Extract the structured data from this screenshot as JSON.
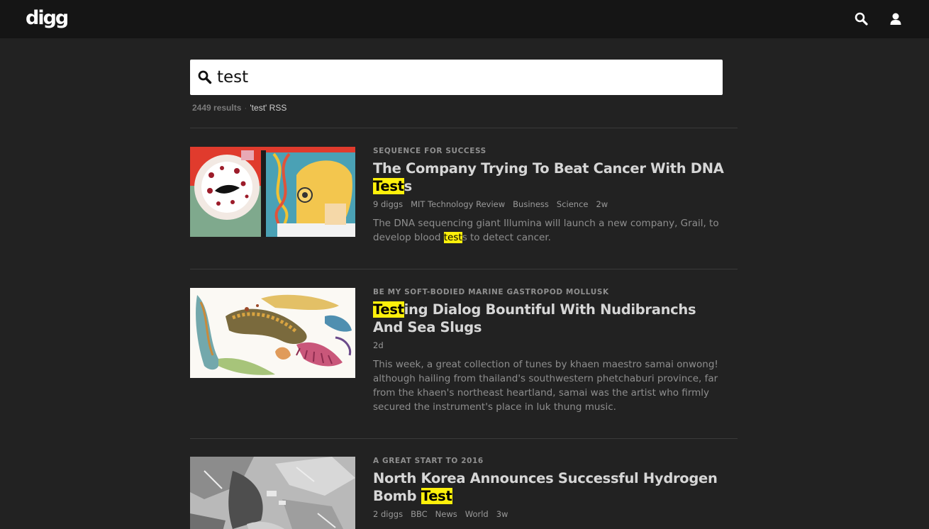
{
  "header": {
    "logo": "digg",
    "search_icon": "search-icon",
    "user_icon": "user-icon"
  },
  "search": {
    "value": "test",
    "icon": "search-icon",
    "results_count": "2449 results",
    "separator": "·",
    "rss_link": "'test' RSS"
  },
  "colors": {
    "background": "#222222",
    "topbar": "#151515",
    "highlight": "#fdf00b",
    "title": "#d6d6d6",
    "meta": "#9a9a9a"
  },
  "stories": [
    {
      "kicker": "SEQUENCE FOR SUCCESS",
      "title_pre": "The Company Trying To Beat Cancer With DNA ",
      "title_hl": "Test",
      "title_post": "s",
      "diggs": "9 diggs",
      "source": "MIT Technology Review",
      "tags": [
        "Business",
        "Science"
      ],
      "age": "2w",
      "desc_pre": "The DNA sequencing giant Illumina will launch a new company, Grail, to develop blood ",
      "desc_hl": "test",
      "desc_post": "s to detect cancer.",
      "image": "illustration-dna-test"
    },
    {
      "kicker": "BE MY SOFT-BODIED MARINE GASTROPOD MOLLUSK",
      "title_pre": "",
      "title_hl": "Test",
      "title_post": "ing Dialog Bountiful With Nudibranchs And Sea Slugs",
      "diggs": "",
      "source": "",
      "tags": [],
      "age": "2d",
      "desc_pre": "This week, a great collection of tunes by khaen maestro samai onwong! although hailing from thailand's southwestern phetchaburi province, far from the khaen's northeast heartland, samai was the artist who firmly secured the instrument's place in luk thung music.",
      "desc_hl": "",
      "desc_post": "",
      "image": "illustration-nudibranchs"
    },
    {
      "kicker": "A GREAT START TO 2016",
      "title_pre": "North Korea Announces Successful Hydrogen Bomb ",
      "title_hl": "Test",
      "title_post": "",
      "diggs": "2 diggs",
      "source": "BBC",
      "tags": [
        "News",
        "World"
      ],
      "age": "3w",
      "desc_pre": "",
      "desc_hl": "",
      "desc_post": "",
      "image": "satellite-photo"
    }
  ]
}
